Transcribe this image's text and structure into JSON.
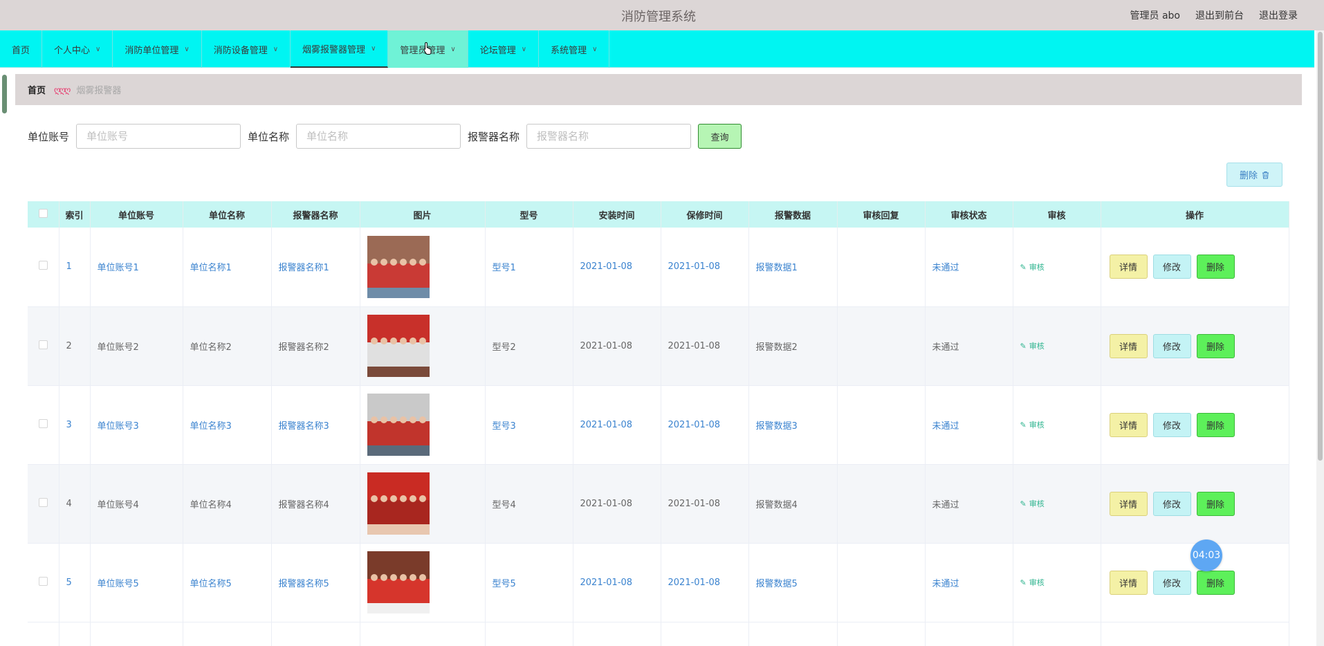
{
  "header": {
    "title": "消防管理系统",
    "admin_label": "管理员 abo",
    "to_front": "退出到前台",
    "logout": "退出登录"
  },
  "nav": {
    "items": [
      {
        "label": "首页",
        "has_dropdown": false
      },
      {
        "label": "个人中心",
        "has_dropdown": true
      },
      {
        "label": "消防单位管理",
        "has_dropdown": true
      },
      {
        "label": "消防设备管理",
        "has_dropdown": true
      },
      {
        "label": "烟雾报警器管理",
        "has_dropdown": true
      },
      {
        "label": "管理员管理",
        "has_dropdown": true
      },
      {
        "label": "论坛管理",
        "has_dropdown": true
      },
      {
        "label": "系统管理",
        "has_dropdown": true
      }
    ],
    "active_index": 4,
    "hover_index": 5
  },
  "breadcrumb": {
    "home": "首页",
    "separator": "ღღღ",
    "current": "烟雾报警器"
  },
  "search": {
    "unit_account_label": "单位账号",
    "unit_account_placeholder": "单位账号",
    "unit_name_label": "单位名称",
    "unit_name_placeholder": "单位名称",
    "alarm_name_label": "报警器名称",
    "alarm_name_placeholder": "报警器名称",
    "query_label": "查询"
  },
  "toolbar": {
    "delete_label": "删除",
    "delete_icon": "trash-icon"
  },
  "table": {
    "headers": {
      "index": "索引",
      "unit_account": "单位账号",
      "unit_name": "单位名称",
      "alarm_name": "报警器名称",
      "image": "图片",
      "model": "型号",
      "install_time": "安装时间",
      "warranty_time": "保修时间",
      "alarm_data": "报警数据",
      "review_reply": "审核回复",
      "review_status": "审核状态",
      "review": "审核",
      "action": "操作"
    },
    "rows": [
      {
        "index": "1",
        "unit_account": "单位账号1",
        "unit_name": "单位名称1",
        "alarm_name": "报警器名称1",
        "model": "型号1",
        "install_time": "2021-01-08",
        "warranty_time": "2021-01-08",
        "alarm_data": "报警数据1",
        "review_reply": "",
        "review_status": "未通过",
        "review_link": "审核"
      },
      {
        "index": "2",
        "unit_account": "单位账号2",
        "unit_name": "单位名称2",
        "alarm_name": "报警器名称2",
        "model": "型号2",
        "install_time": "2021-01-08",
        "warranty_time": "2021-01-08",
        "alarm_data": "报警数据2",
        "review_reply": "",
        "review_status": "未通过",
        "review_link": "审核"
      },
      {
        "index": "3",
        "unit_account": "单位账号3",
        "unit_name": "单位名称3",
        "alarm_name": "报警器名称3",
        "model": "型号3",
        "install_time": "2021-01-08",
        "warranty_time": "2021-01-08",
        "alarm_data": "报警数据3",
        "review_reply": "",
        "review_status": "未通过",
        "review_link": "审核"
      },
      {
        "index": "4",
        "unit_account": "单位账号4",
        "unit_name": "单位名称4",
        "alarm_name": "报警器名称4",
        "model": "型号4",
        "install_time": "2021-01-08",
        "warranty_time": "2021-01-08",
        "alarm_data": "报警数据4",
        "review_reply": "",
        "review_status": "未通过",
        "review_link": "审核"
      },
      {
        "index": "5",
        "unit_account": "单位账号5",
        "unit_name": "单位名称5",
        "alarm_name": "报警器名称5",
        "model": "型号5",
        "install_time": "2021-01-08",
        "warranty_time": "2021-01-08",
        "alarm_data": "报警数据5",
        "review_reply": "",
        "review_status": "未通过",
        "review_link": "审核"
      }
    ],
    "actions": {
      "detail": "详情",
      "edit": "修改",
      "delete": "删除"
    }
  },
  "timer": "04:03"
}
